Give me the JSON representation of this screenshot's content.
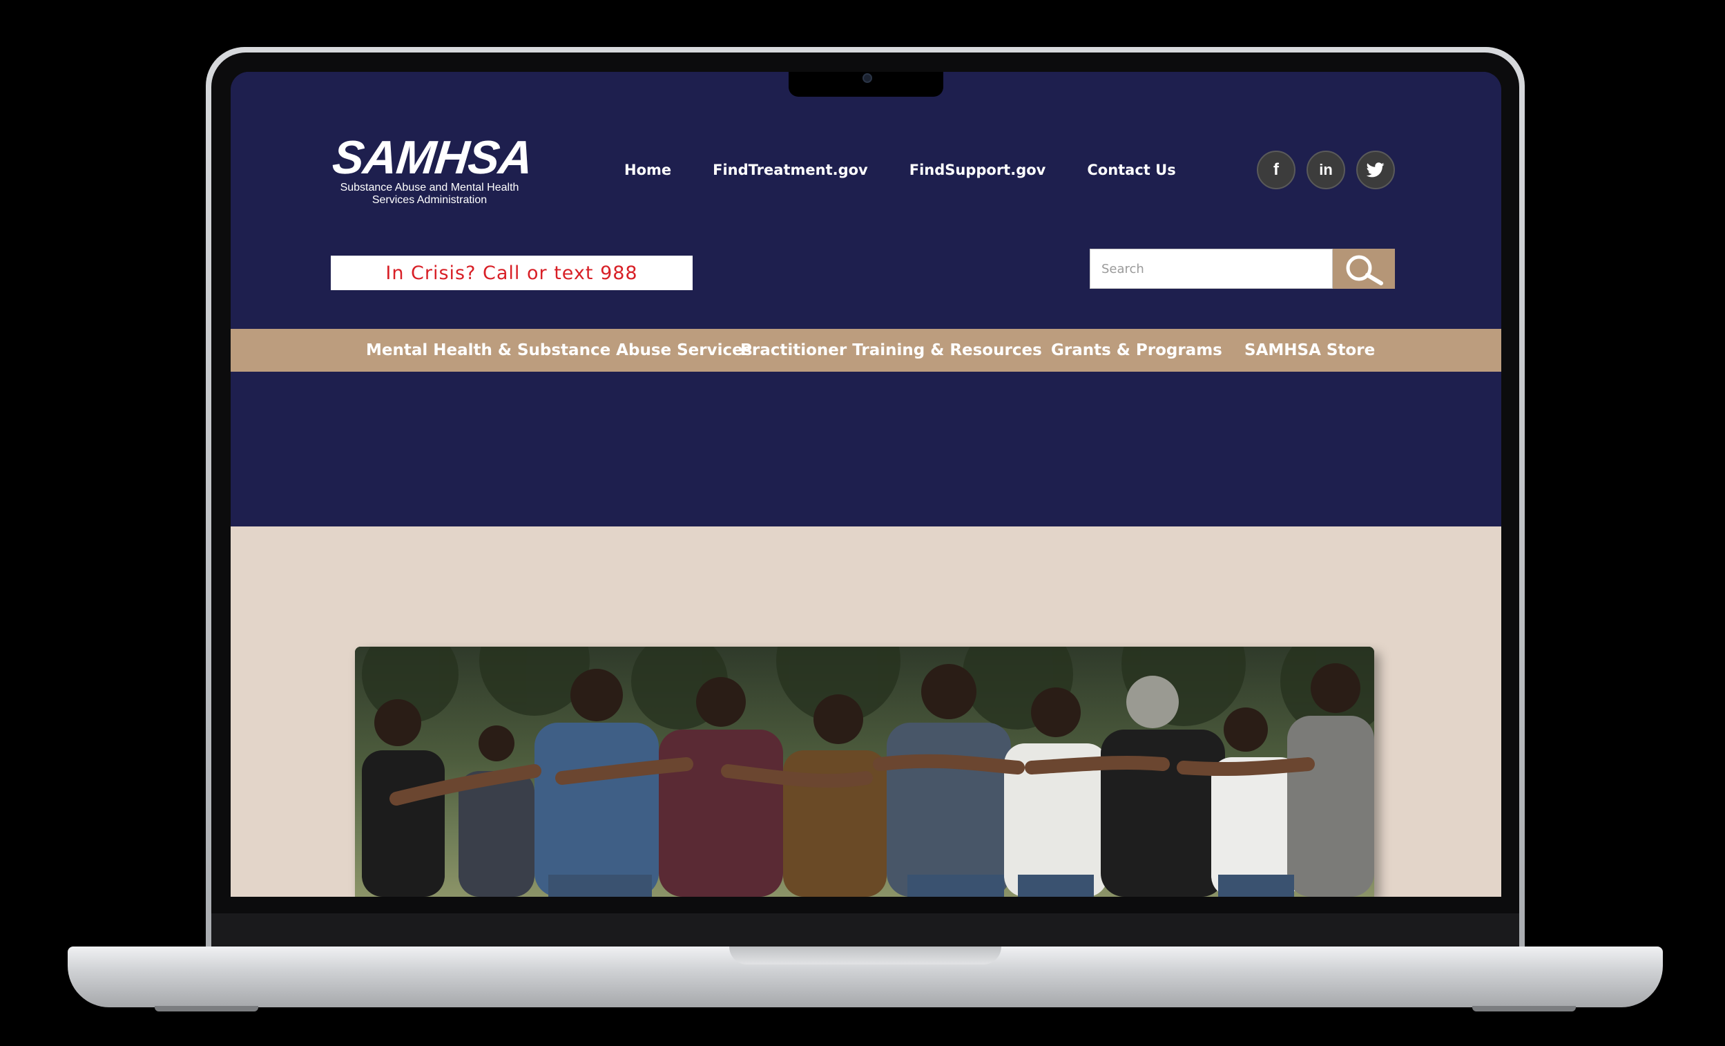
{
  "brand": {
    "logo_text": "SAMHSA",
    "logo_subtitle_line1": "Substance Abuse and Mental Health",
    "logo_subtitle_line2": "Services Administration"
  },
  "top_nav": [
    "Home",
    "FindTreatment.gov",
    "FindSupport.gov",
    "Contact Us"
  ],
  "socials": [
    {
      "icon": "facebook-icon",
      "glyph": "f"
    },
    {
      "icon": "linkedin-icon",
      "glyph": "in"
    },
    {
      "icon": "twitter-icon",
      "glyph": "🐦"
    }
  ],
  "crisis_text": "In Crisis? Call or text 988",
  "search": {
    "placeholder": "Search",
    "value": ""
  },
  "main_nav": [
    "Mental Health & Substance Abuse Services",
    "Practitioner Training & Resources",
    "Grants & Programs",
    "SAMHSA Store"
  ],
  "colors": {
    "navy": "#1e1f4e",
    "tan": "#bc9d7e",
    "beige": "#e3d5c9",
    "crisis_red": "#d81f26",
    "search_button": "#b59677"
  }
}
